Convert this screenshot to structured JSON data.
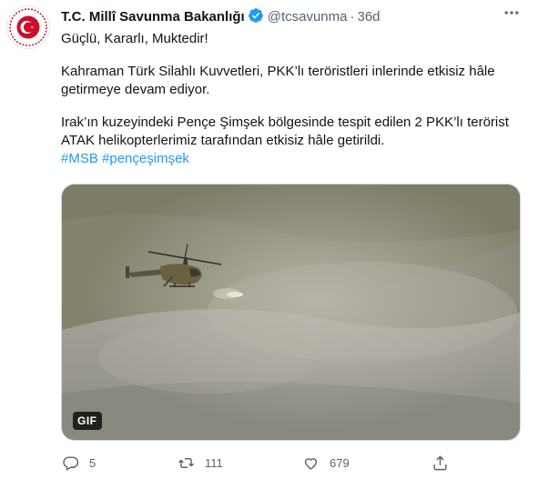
{
  "account": {
    "name": "T.C. Millî Savunma Bakanlığı",
    "handle": "@tcsavunma",
    "separator": "·",
    "time": "36d",
    "verified": true
  },
  "tweet": {
    "line1": "Güçlü, Kararlı, Muktedir!",
    "para2_line1": "Kahraman Türk Silahlı Kuvvetleri, PKK’lı teröristleri inlerinde etkisiz hâle",
    "para2_line2": "getirmeye devam ediyor.",
    "para3_line1": "Irak’ın kuzeyindeki Pençe Şimşek bölgesinde tespit edilen 2 PKK’lı terörist",
    "para3_line2": "ATAK helikopterlerimiz tarafından etkisiz hâle getirildi.",
    "hashtags": [
      "#MSB",
      "#pençeşimşek"
    ]
  },
  "media": {
    "badge": "GIF"
  },
  "actions": {
    "reply_count": "5",
    "retweet_count": "111",
    "like_count": "679"
  },
  "icons": {
    "verified": "verified-badge-icon",
    "more": "more-icon",
    "reply": "reply-icon",
    "retweet": "retweet-icon",
    "like": "heart-icon",
    "share": "share-icon"
  },
  "colors": {
    "link": "#1d9bf0",
    "secondary": "#536471",
    "logo_red": "#c8102e"
  }
}
